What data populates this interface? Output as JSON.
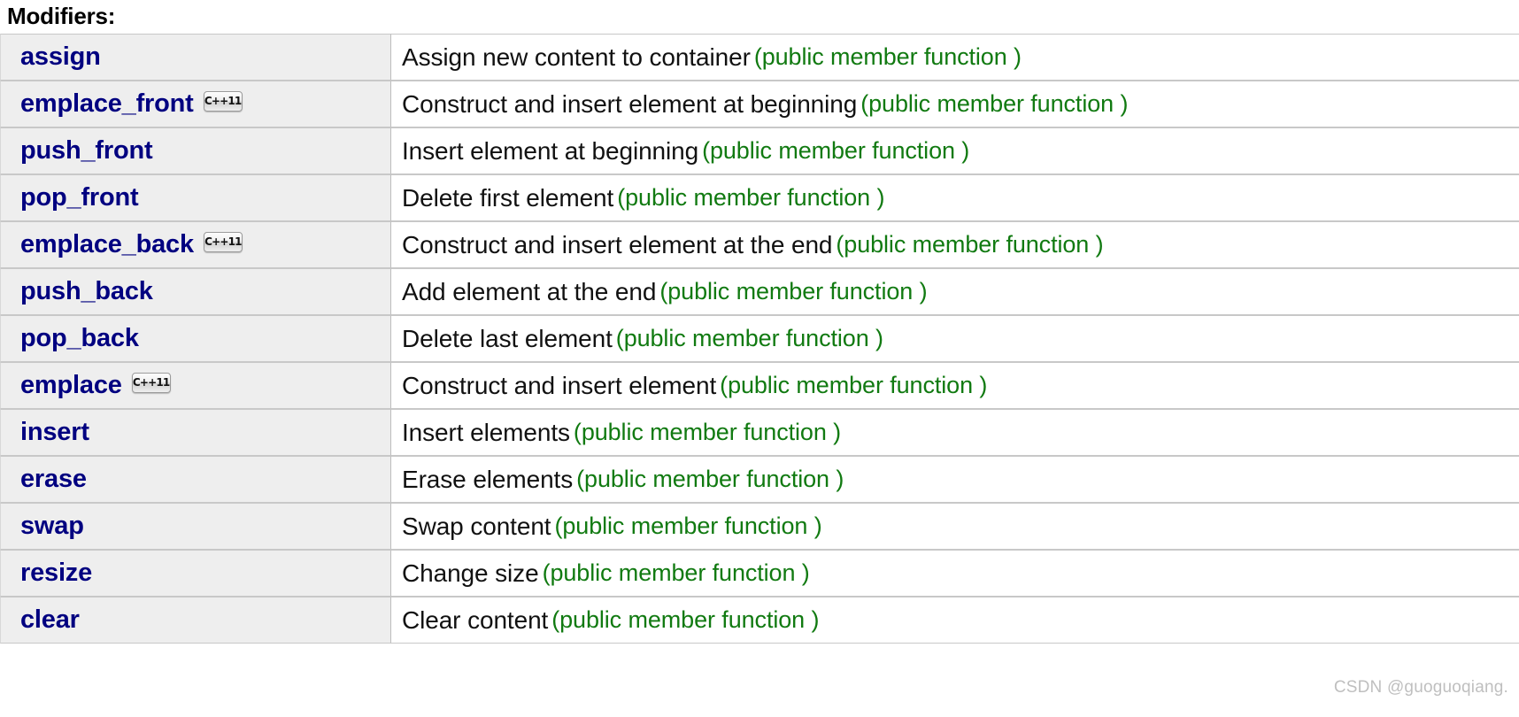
{
  "section": {
    "heading": "Modifiers:"
  },
  "badge": {
    "label": "C++11"
  },
  "watermark": {
    "text": "CSDN @guoguoqiang."
  },
  "colors": {
    "link": "#000080",
    "kind": "#117a11",
    "name_cell_bg": "#eeeeee",
    "desc_cell_bg": "#ffffff",
    "row_border": "#c8c8c8",
    "watermark": "#bfbfbf"
  },
  "table": {
    "kind_label": "(public member function )",
    "rows": [
      {
        "name": "assign",
        "badge": false,
        "desc": "Assign new content to container",
        "kind": "(public member function )"
      },
      {
        "name": "emplace_front",
        "badge": true,
        "desc": "Construct and insert element at beginning",
        "kind": "(public member function )"
      },
      {
        "name": "push_front",
        "badge": false,
        "desc": "Insert element at beginning",
        "kind": "(public member function )"
      },
      {
        "name": "pop_front",
        "badge": false,
        "desc": "Delete first element",
        "kind": "(public member function )"
      },
      {
        "name": "emplace_back",
        "badge": true,
        "desc": "Construct and insert element at the end",
        "kind": "(public member function )"
      },
      {
        "name": "push_back",
        "badge": false,
        "desc": "Add element at the end",
        "kind": "(public member function )"
      },
      {
        "name": "pop_back",
        "badge": false,
        "desc": "Delete last element",
        "kind": "(public member function )"
      },
      {
        "name": "emplace",
        "badge": true,
        "desc": "Construct and insert element",
        "kind": "(public member function )"
      },
      {
        "name": "insert",
        "badge": false,
        "desc": "Insert elements",
        "kind": "(public member function )"
      },
      {
        "name": "erase",
        "badge": false,
        "desc": "Erase elements",
        "kind": "(public member function )"
      },
      {
        "name": "swap",
        "badge": false,
        "desc": "Swap content",
        "kind": "(public member function )"
      },
      {
        "name": "resize",
        "badge": false,
        "desc": "Change size",
        "kind": "(public member function )"
      },
      {
        "name": "clear",
        "badge": false,
        "desc": "Clear content",
        "kind": "(public member function )"
      }
    ]
  }
}
